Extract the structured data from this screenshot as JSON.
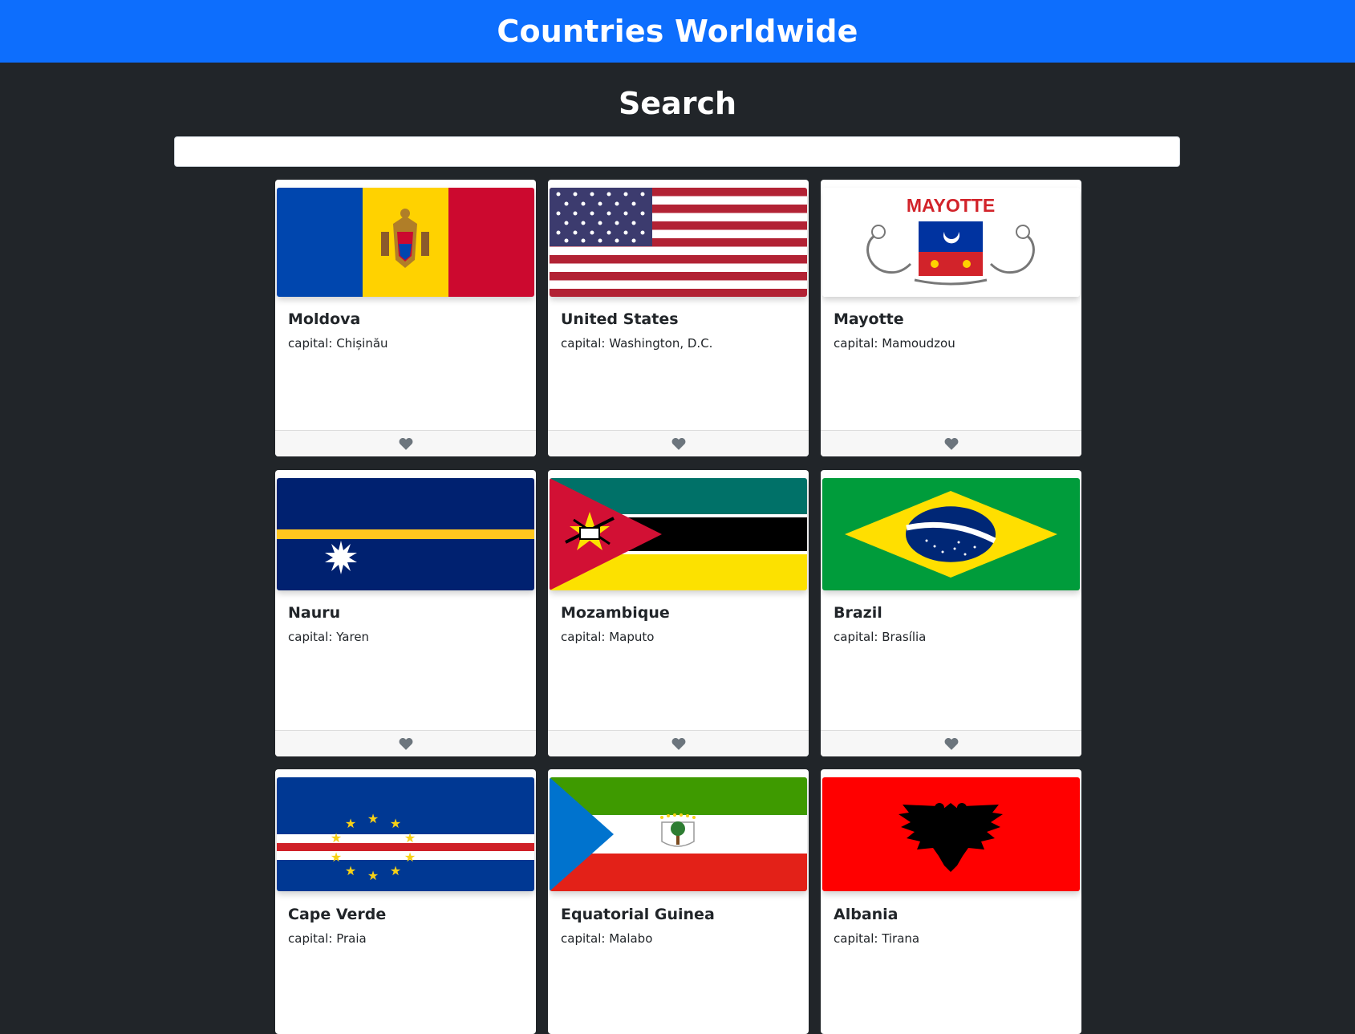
{
  "header": {
    "title": "Countries Worldwide"
  },
  "search": {
    "title": "Search",
    "value": "",
    "placeholder": ""
  },
  "capital_prefix": "capital:",
  "countries": [
    {
      "name": "Moldova",
      "capital": "capital: Chișinău"
    },
    {
      "name": "United States",
      "capital": "capital: Washington, D.C."
    },
    {
      "name": "Mayotte",
      "capital": "capital: Mamoudzou",
      "flag_text": "MAYOTTE"
    },
    {
      "name": "Nauru",
      "capital": "capital: Yaren"
    },
    {
      "name": "Mozambique",
      "capital": "capital: Maputo"
    },
    {
      "name": "Brazil",
      "capital": "capital: Brasília"
    },
    {
      "name": "Cape Verde",
      "capital": "capital: Praia"
    },
    {
      "name": "Equatorial Guinea",
      "capital": "capital: Malabo"
    },
    {
      "name": "Albania",
      "capital": "capital: Tirana"
    }
  ],
  "colors": {
    "navbar": "#0d6efd",
    "background": "#212529",
    "heart": "#6c757d"
  },
  "icons": {
    "favorite": "heart-icon"
  }
}
